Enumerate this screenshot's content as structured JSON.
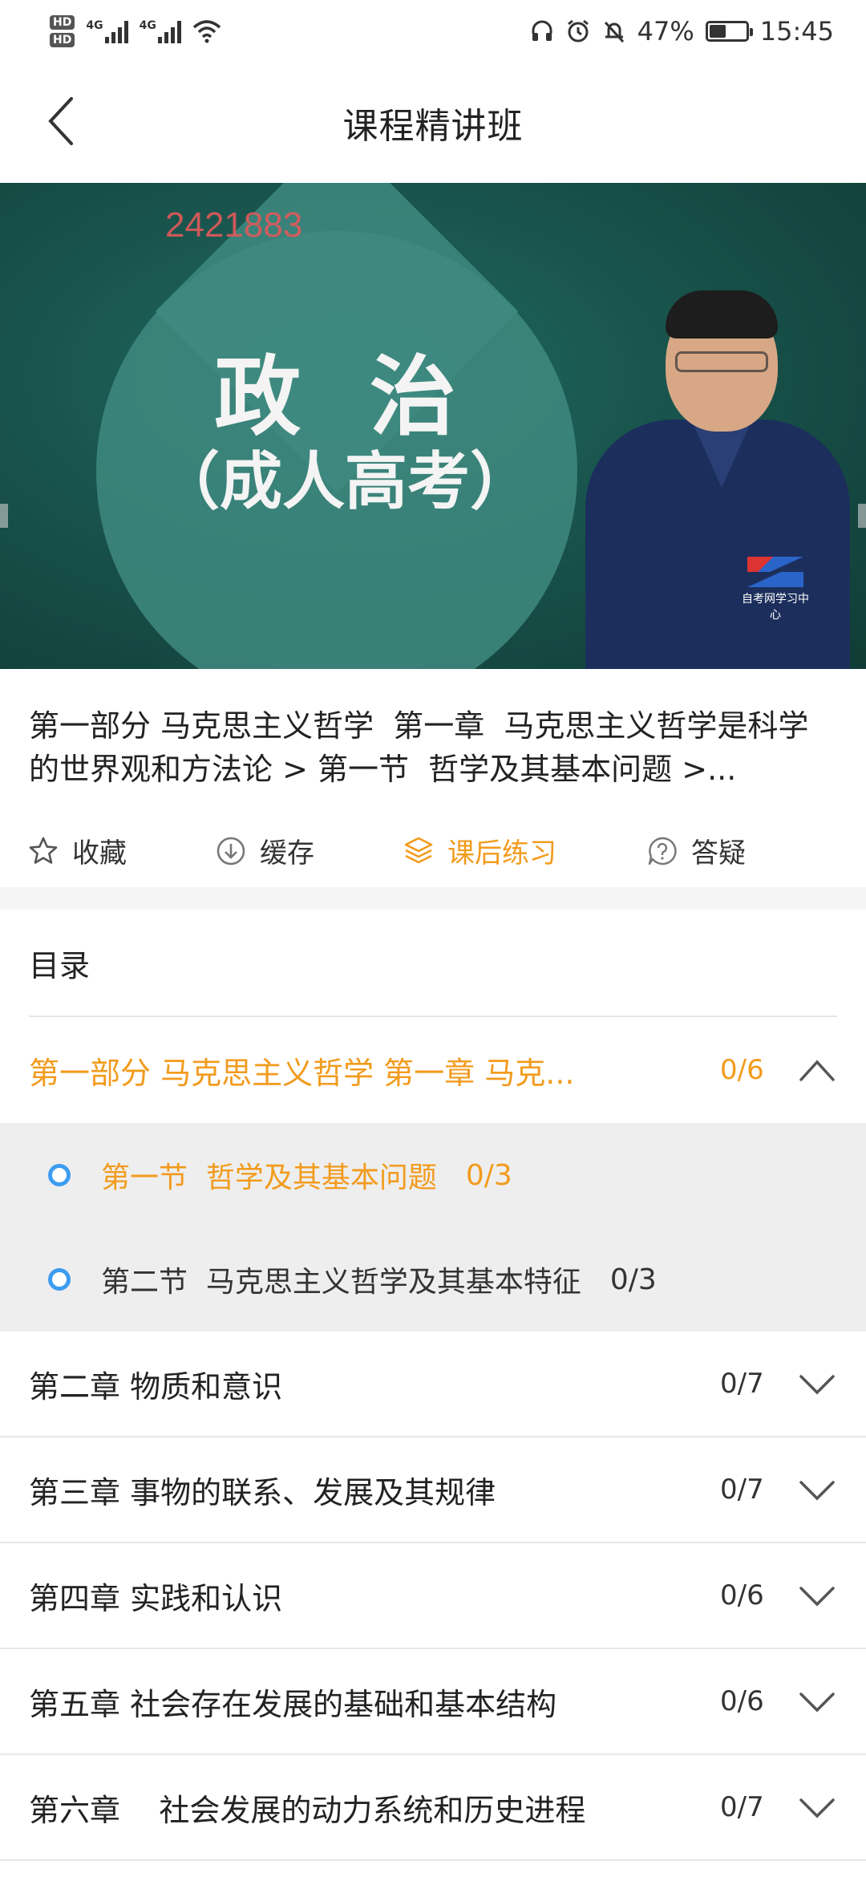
{
  "status_bar": {
    "hd1": "HD",
    "hd2": "HD",
    "net1": "4G",
    "net2": "4G",
    "battery_percent_text": "47%",
    "battery_level": 0.47,
    "time": "15:45",
    "icons": [
      "headphones-icon",
      "alarm-icon",
      "mute-icon"
    ]
  },
  "header": {
    "title": "课程精讲班"
  },
  "video": {
    "watermark_id": "2421883",
    "title": "政  治",
    "subtitle": "（成人高考）",
    "logo_text": "自考网学习中心"
  },
  "lesson": {
    "breadcrumb": "第一部分 马克思主义哲学  第一章  马克思主义哲学是科学的世界观和方法论 > 第一节  哲学及其基本问题 >..."
  },
  "actions": [
    {
      "label": "收藏",
      "icon": "star-icon",
      "active": false
    },
    {
      "label": "缓存",
      "icon": "download-icon",
      "active": false
    },
    {
      "label": "课后练习",
      "icon": "layers-icon",
      "active": true
    },
    {
      "label": "答疑",
      "icon": "question-icon",
      "active": false
    }
  ],
  "catalog": {
    "title": "目录",
    "chapters": [
      {
        "title": "第一部分 马克思主义哲学  第一章  马克...",
        "count": "0/6",
        "expanded": true,
        "sections": [
          {
            "title": "第一节  哲学及其基本问题",
            "count": "0/3",
            "active": true
          },
          {
            "title": "第二节  马克思主义哲学及其基本特征",
            "count": "0/3",
            "active": false
          }
        ]
      },
      {
        "title": "第二章  物质和意识",
        "count": "0/7",
        "expanded": false
      },
      {
        "title": "第三章 事物的联系、发展及其规律",
        "count": "0/7",
        "expanded": false
      },
      {
        "title": "第四章 实践和认识",
        "count": "0/6",
        "expanded": false
      },
      {
        "title": "第五章 社会存在发展的基础和基本结构",
        "count": "0/6",
        "expanded": false
      },
      {
        "title": "第六章    社会发展的动力系统和历史进程",
        "count": "0/7",
        "expanded": false
      }
    ]
  },
  "colors": {
    "accent": "#f29b1d",
    "section_dot": "#3c9cf0",
    "video_bg": "#174f48"
  }
}
